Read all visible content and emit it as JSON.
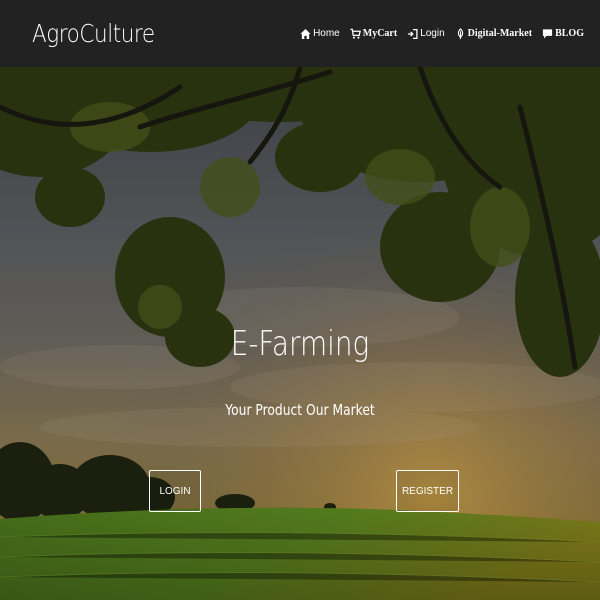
{
  "brand": "AgroCulture",
  "nav": {
    "items": [
      {
        "label": "Home",
        "icon": "home-icon"
      },
      {
        "label": "MyCart",
        "icon": "cart-icon"
      },
      {
        "label": "Login",
        "icon": "login-icon"
      },
      {
        "label": "Digital-Market",
        "icon": "leaf-icon"
      },
      {
        "label": "BLOG",
        "icon": "comment-icon"
      }
    ]
  },
  "hero": {
    "title": "E-Farming",
    "subtitle": "Your Product Our Market",
    "login_label": "LOGIN",
    "register_label": "REGISTER",
    "background": "hero-landscape-image"
  },
  "colors": {
    "navbar": "#222222",
    "text": "#ffffff"
  }
}
